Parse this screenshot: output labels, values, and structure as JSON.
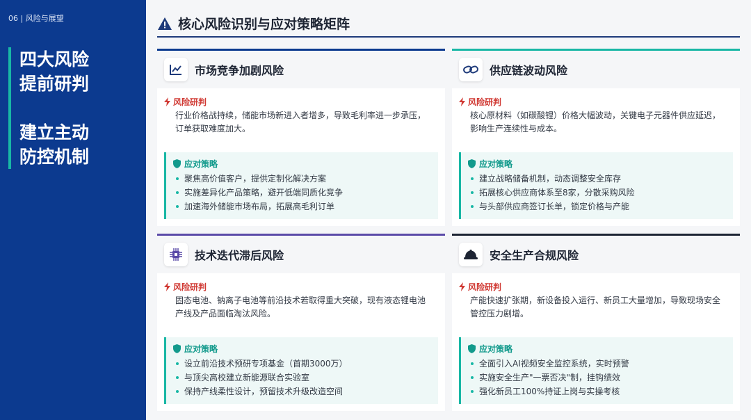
{
  "sidebar": {
    "crumb": "06 | 风险与展望",
    "headline": [
      "四大风险",
      "提前研判",
      "建立主动",
      "防控机制"
    ]
  },
  "page": {
    "title": "核心风险识别与应对策略矩阵",
    "risk_label": "风险研判",
    "strategy_label": "应对策略"
  },
  "colors": {
    "sidebar": "#0c3a8f",
    "accent_teal": "#18b7a5",
    "risk_red": "#d03a34"
  },
  "cards": [
    {
      "title": "市场竞争加剧风险",
      "icon": "line-chart-icon",
      "bar_color": "#0c3a8f",
      "risk": "行业价格战持续，储能市场新进入者增多，导致毛利率进一步承压，订单获取难度加大。",
      "strategies": [
        "聚焦高价值客户，提供定制化解决方案",
        "实施差异化产品策略，避开低端同质化竞争",
        "加速海外储能市场布局，拓展高毛利订单"
      ]
    },
    {
      "title": "供应链波动风险",
      "icon": "link-icon",
      "bar_color": "#18b7a5",
      "risk": "核心原材料（如碳酸锂）价格大幅波动，关键电子元器件供应延迟，影响生产连续性与成本。",
      "strategies": [
        "建立战略储备机制，动态调整安全库存",
        "拓展核心供应商体系至8家，分散采购风险",
        "与头部供应商签订长单，锁定价格与产能"
      ]
    },
    {
      "title": "技术迭代滞后风险",
      "icon": "chip-icon",
      "bar_color": "#5b4aa8",
      "risk": "固态电池、钠离子电池等前沿技术若取得重大突破，现有液态锂电池产线及产品面临淘汰风险。",
      "strategies": [
        "设立前沿技术预研专项基金（首期3000万）",
        "与顶尖高校建立新能源联合实验室",
        "保持产线柔性设计，预留技术升级改造空间"
      ]
    },
    {
      "title": "安全生产合规风险",
      "icon": "hard-hat-icon",
      "bar_color": "#1d2433",
      "risk": "产能快速扩张期，新设备投入运行、新员工大量增加，导致现场安全管控压力剧增。",
      "strategies": [
        "全面引入AI视频安全监控系统，实时预警",
        "实施安全生产\"一票否决\"制，挂钩绩效",
        "强化新员工100%持证上岗与实操考核"
      ]
    }
  ]
}
